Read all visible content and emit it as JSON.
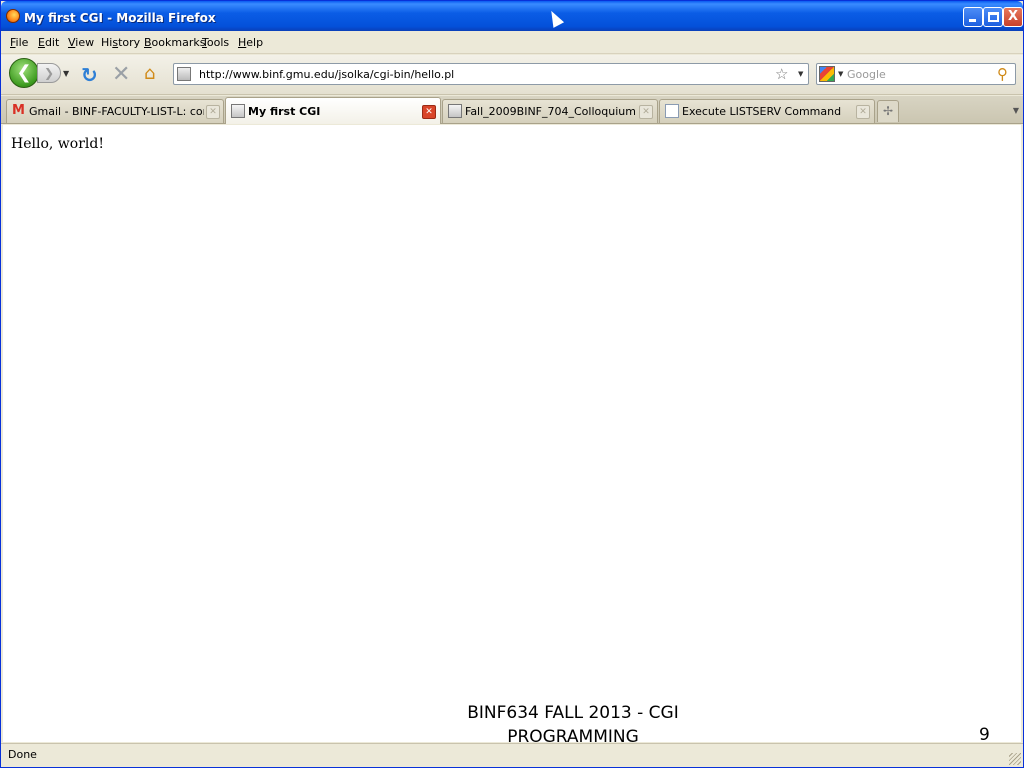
{
  "window": {
    "title": "My first CGI - Mozilla Firefox",
    "minimize_label": "",
    "maximize_label": "",
    "close_label": "X"
  },
  "menu": {
    "file": {
      "accel": "F",
      "rest": "ile"
    },
    "edit": {
      "accel": "E",
      "rest": "dit"
    },
    "view": {
      "accel": "V",
      "rest": "iew"
    },
    "history": {
      "pre": "Hi",
      "accel": "s",
      "rest": "tory"
    },
    "bookmarks": {
      "accel": "B",
      "rest": "ookmarks"
    },
    "tools": {
      "accel": "T",
      "rest": "ools"
    },
    "help": {
      "accel": "H",
      "rest": "elp"
    }
  },
  "navbar": {
    "back_glyph": "❮",
    "forward_glyph": "❯",
    "url": "http://www.binf.gmu.edu/jsolka/cgi-bin/hello.pl",
    "search_placeholder": "Google"
  },
  "tabs": [
    {
      "label": "Gmail - BINF-FACULTY-LIST-L: confirma...",
      "icon": "gmail-icon",
      "active": false
    },
    {
      "label": "My first CGI",
      "icon": "page-icon",
      "active": true
    },
    {
      "label": "Fall_2009BINF_704_Colloquium",
      "icon": "page-icon",
      "active": false
    },
    {
      "label": "Execute LISTSERV Command",
      "icon": "doc-icon",
      "active": false
    }
  ],
  "content": {
    "body_text": "Hello, world!"
  },
  "slide": {
    "footer_line1": "BINF634 FALL 2013 - CGI",
    "footer_line2": "PROGRAMMING",
    "page_number": "9"
  },
  "status": {
    "text": "Done"
  },
  "colors": {
    "titlebar": "#0350d9",
    "chrome": "#ece9d8",
    "close_button": "#d9452a"
  }
}
